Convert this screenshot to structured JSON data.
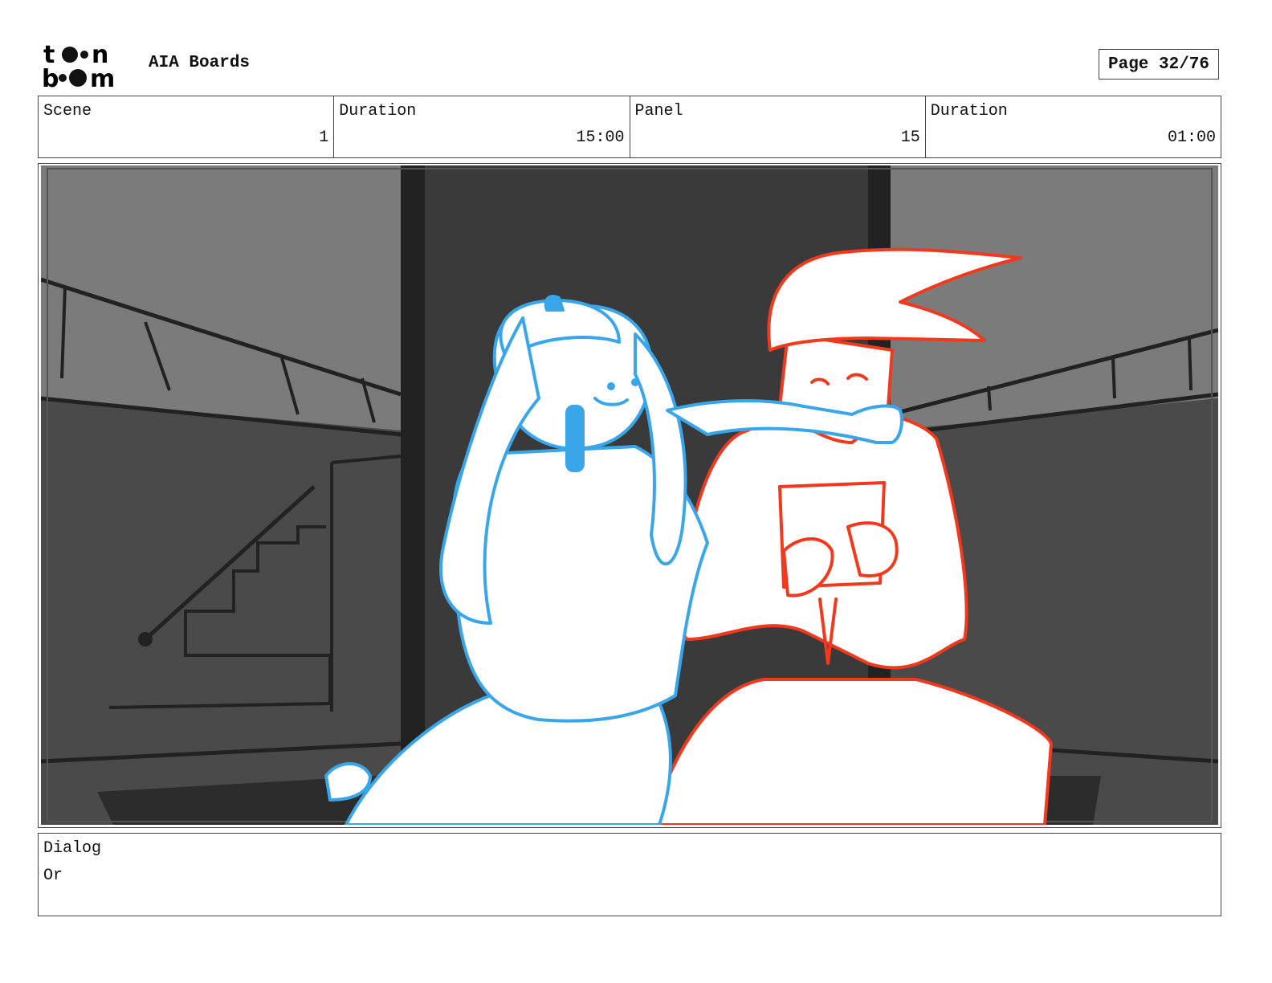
{
  "header": {
    "logo_text": "toon boom",
    "project_title": "AIA Boards",
    "page_label": "Page 32/76"
  },
  "info": [
    {
      "label": "Scene",
      "value": "1"
    },
    {
      "label": "Duration",
      "value": "15:00"
    },
    {
      "label": "Panel",
      "value": "15"
    },
    {
      "label": "Duration",
      "value": "01:00"
    }
  ],
  "panel": {
    "background_colors": [
      "#7b7b7b",
      "#3a3a3a",
      "#4a4a4a"
    ],
    "character_left_color": "#39a6ea",
    "character_right_color": "#f2391e"
  },
  "dialog": {
    "label": "Dialog",
    "text": "Or"
  }
}
